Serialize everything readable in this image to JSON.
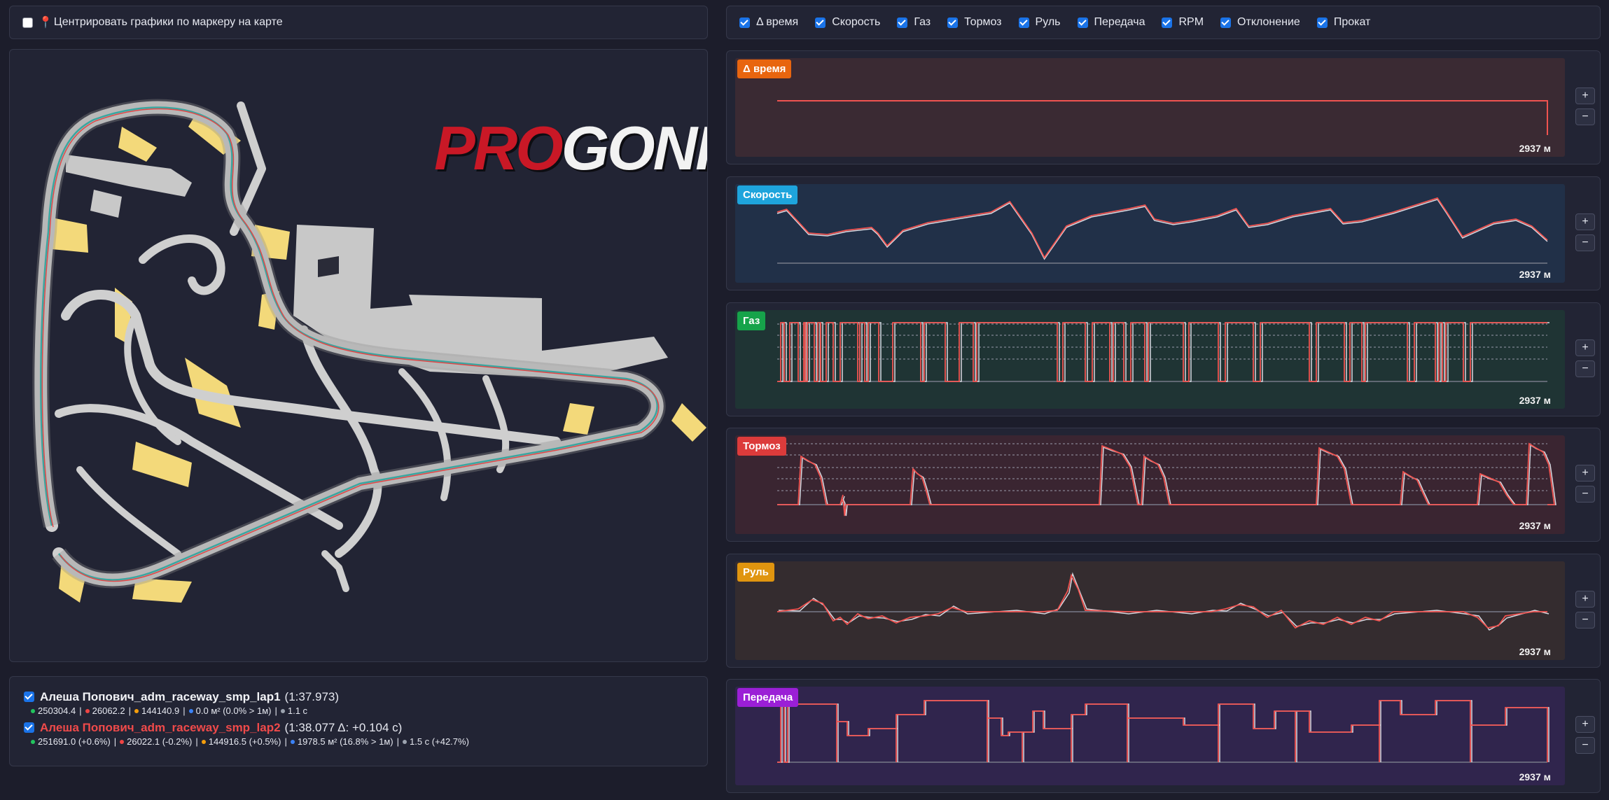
{
  "top_left": {
    "center_checkbox_checked": false,
    "center_label": "Центрировать графики по маркеру на карте"
  },
  "channel_toggles": [
    {
      "label": "Δ время",
      "checked": true
    },
    {
      "label": "Скорость",
      "checked": true
    },
    {
      "label": "Газ",
      "checked": true
    },
    {
      "label": "Тормоз",
      "checked": true
    },
    {
      "label": "Руль",
      "checked": true
    },
    {
      "label": "Передача",
      "checked": true
    },
    {
      "label": "RPM",
      "checked": true
    },
    {
      "label": "Отклонение",
      "checked": true
    },
    {
      "label": "Прокат",
      "checked": true
    }
  ],
  "map": {
    "logo_part1": "PRO",
    "logo_part2": "GONKi"
  },
  "laps": [
    {
      "checked": true,
      "name": "Алеша Попович_adm_raceway_smp_lap1",
      "time": "(1:37.973)",
      "color": "#f2f3f7",
      "stats": [
        {
          "color": "#22c55e",
          "text": "250304.4"
        },
        {
          "color": "#ef4444",
          "text": "26062.2"
        },
        {
          "color": "#f59e0b",
          "text": "144140.9"
        },
        {
          "color": "#3b82f6",
          "text": "0.0 м² (0.0% > 1м)"
        },
        {
          "color": "#9ca3af",
          "text": "1.1 с"
        }
      ]
    },
    {
      "checked": true,
      "name": "Алеша Попович_adm_raceway_smp_lap2",
      "time": "(1:38.077 Δ: +0.104 с)",
      "color": "#f04a4a",
      "stats": [
        {
          "color": "#22c55e",
          "text": "251691.0 (+0.6%)"
        },
        {
          "color": "#ef4444",
          "text": "26022.1 (-0.2%)"
        },
        {
          "color": "#f59e0b",
          "text": "144916.5 (+0.5%)"
        },
        {
          "color": "#3b82f6",
          "text": "1978.5 м² (16.8% > 1м)"
        },
        {
          "color": "#9ca3af",
          "text": "1.5 с (+42.7%)"
        }
      ]
    }
  ],
  "charts": [
    {
      "key": "delta",
      "label": "Δ время",
      "badge_color": "#e8650f",
      "bg": "#3a2a33",
      "distance": "2937 м"
    },
    {
      "key": "speed",
      "label": "Скорость",
      "badge_color": "#1ea4dc",
      "bg": "#213048",
      "distance": "2937 м"
    },
    {
      "key": "throttle",
      "label": "Газ",
      "badge_color": "#16a34a",
      "bg": "#1f3434",
      "distance": "2937 м"
    },
    {
      "key": "brake",
      "label": "Тормоз",
      "badge_color": "#dc3b3b",
      "bg": "#3a2531",
      "distance": "2937 м"
    },
    {
      "key": "steering",
      "label": "Руль",
      "badge_color": "#e0950f",
      "bg": "#342c2f",
      "distance": "2937 м"
    },
    {
      "key": "gear",
      "label": "Передача",
      "badge_color": "#9b1fd6",
      "bg": "#30254d",
      "distance": "2937 м"
    }
  ],
  "zoom": {
    "plus": "+",
    "minus": "−"
  }
}
